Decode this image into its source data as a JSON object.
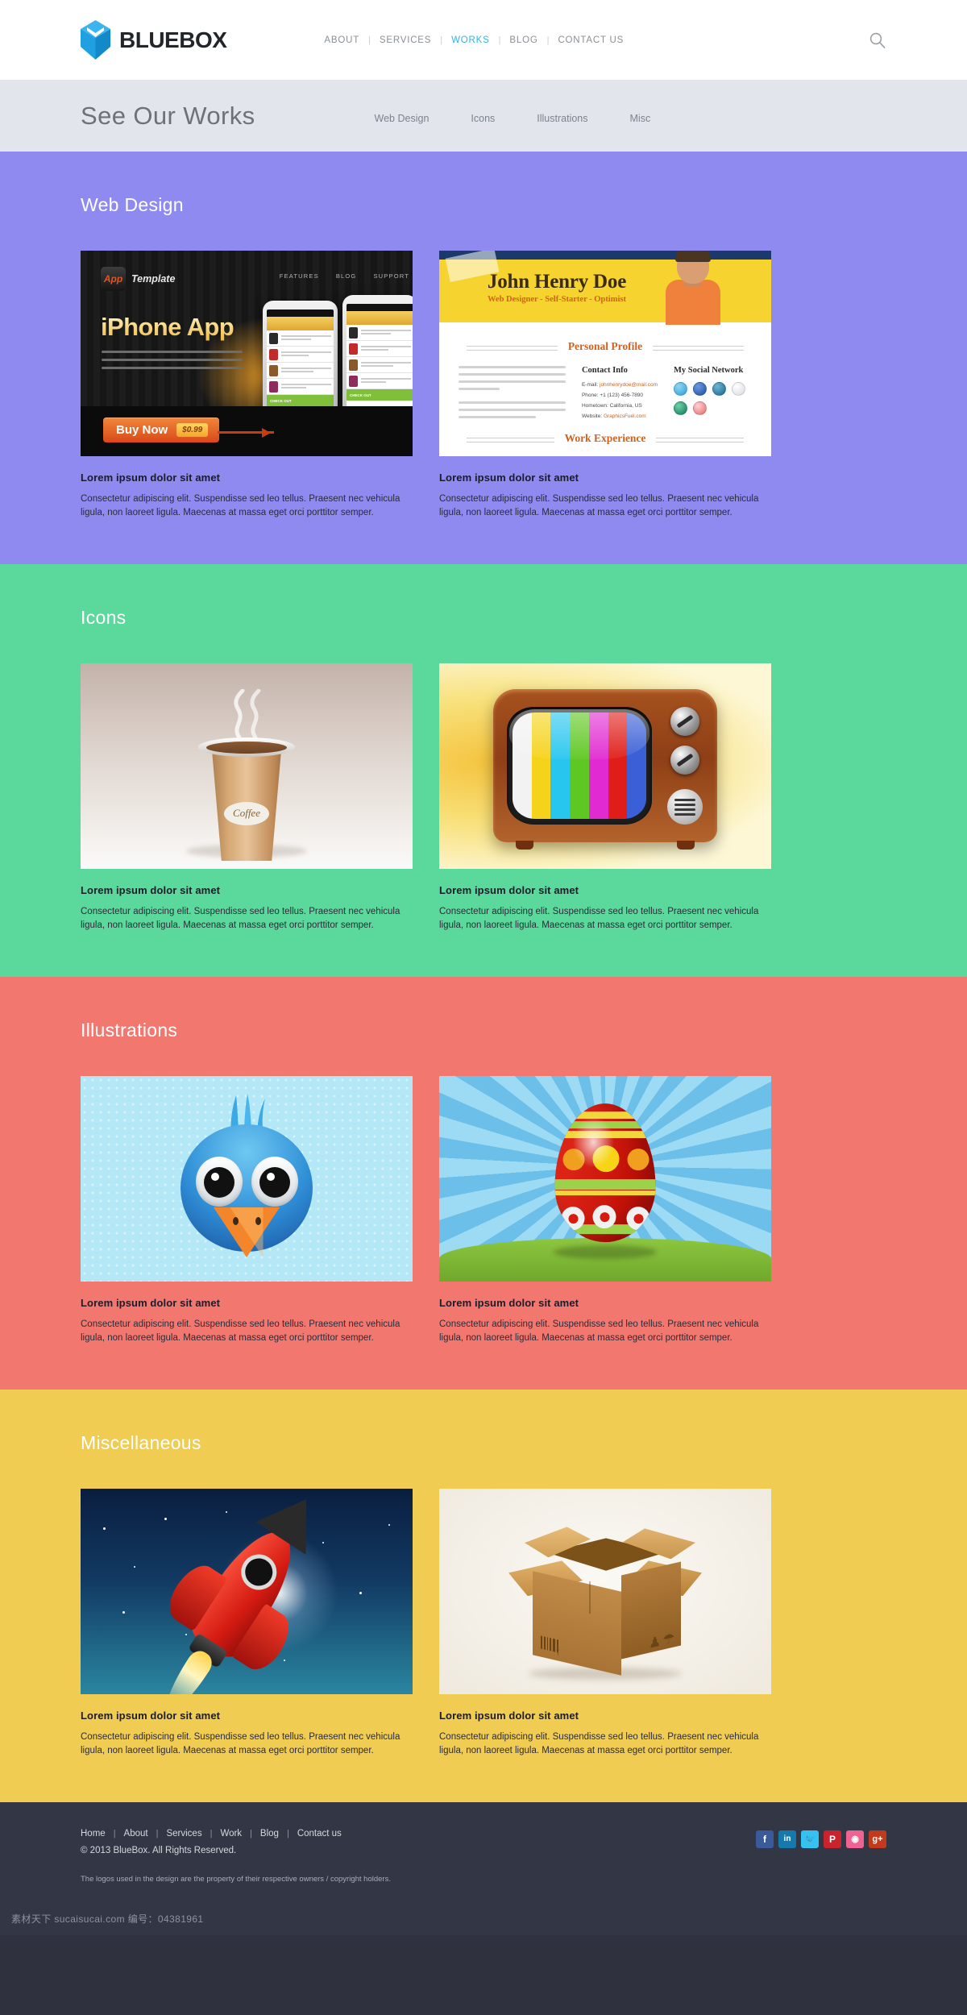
{
  "header": {
    "brand": "BLUEBOX",
    "nav": [
      {
        "label": "ABOUT",
        "active": false
      },
      {
        "label": "SERVICES",
        "active": false
      },
      {
        "label": "WORKS",
        "active": true
      },
      {
        "label": "BLOG",
        "active": false
      },
      {
        "label": "CONTACT US",
        "active": false
      }
    ],
    "separator": "|",
    "search_icon": "search-icon",
    "accent_color": "#2bb6e8"
  },
  "titlebar": {
    "title": "See Our Works",
    "filters": [
      "Web Design",
      "Icons",
      "Illustrations",
      "Misc"
    ]
  },
  "sections": [
    {
      "id": "web-design",
      "title": "Web Design",
      "bg": "#8e8af0",
      "cards": [
        {
          "title": "Lorem ipsum dolor sit amet",
          "desc": "Consectetur adipiscing elit. Suspendisse sed leo tellus. Praesent nec vehicula ligula, non laoreet ligula. Maecenas at massa eget orci porttitor semper.",
          "art": "iphone-app-promo"
        },
        {
          "title": "Lorem ipsum dolor sit amet",
          "desc": "Consectetur adipiscing elit. Suspendisse sed leo tellus. Praesent nec vehicula ligula, non laoreet ligula. Maecenas at massa eget orci porttitor semper.",
          "art": "resume-cv-template"
        }
      ]
    },
    {
      "id": "icons",
      "title": "Icons",
      "bg": "#5bd89b",
      "cards": [
        {
          "title": "Lorem ipsum dolor sit amet",
          "desc": "Consectetur adipiscing elit. Suspendisse sed leo tellus. Praesent nec vehicula ligula, non laoreet ligula. Maecenas at massa eget orci porttitor semper.",
          "art": "coffee-cup-icon"
        },
        {
          "title": "Lorem ipsum dolor sit amet",
          "desc": "Consectetur adipiscing elit. Suspendisse sed leo tellus. Praesent nec vehicula ligula, non laoreet ligula. Maecenas at massa eget orci porttitor semper.",
          "art": "retro-tv-icon"
        }
      ]
    },
    {
      "id": "illustrations",
      "title": "Illustrations",
      "bg": "#f2786f",
      "cards": [
        {
          "title": "Lorem ipsum dolor sit amet",
          "desc": "Consectetur adipiscing elit. Suspendisse sed leo tellus. Praesent nec vehicula ligula, non laoreet ligula. Maecenas at massa eget orci porttitor semper.",
          "art": "blue-bird-illustration"
        },
        {
          "title": "Lorem ipsum dolor sit amet",
          "desc": "Consectetur adipiscing elit. Suspendisse sed leo tellus. Praesent nec vehicula ligula, non laoreet ligula. Maecenas at massa eget orci porttitor semper.",
          "art": "easter-egg-illustration"
        }
      ]
    },
    {
      "id": "misc",
      "title": "Miscellaneous",
      "bg": "#f0cc52",
      "cards": [
        {
          "title": "Lorem ipsum dolor sit amet",
          "desc": "Consectetur adipiscing elit. Suspendisse sed leo tellus. Praesent nec vehicula ligula, non laoreet ligula. Maecenas at massa eget orci porttitor semper.",
          "art": "rocket-illustration"
        },
        {
          "title": "Lorem ipsum dolor sit amet",
          "desc": "Consectetur adipiscing elit. Suspendisse sed leo tellus. Praesent nec vehicula ligula, non laoreet ligula. Maecenas at massa eget orci porttitor semper.",
          "art": "cardboard-box-icon"
        }
      ]
    }
  ],
  "thumb_art": {
    "iphone": {
      "logo_badge": "App",
      "logo_word": "Template",
      "nav": [
        "FEATURES",
        "BLOG",
        "SUPPORT"
      ],
      "headline": "iPhone App",
      "buy_label": "Buy Now",
      "price": "$0.99",
      "checkout": "CHECK OUT"
    },
    "cv": {
      "name": "John Henry Doe",
      "role": "Web Designer - Self-Starter - Optimist",
      "profile_heading": "Personal Profile",
      "contact_heading": "Contact Info",
      "social_heading": "My Social Network",
      "work_heading": "Work Experience",
      "email_label": "E-mail:",
      "email": "johnhenrydoe@mail.com",
      "phone_label": "Phone:",
      "phone": "+1 (123) 456-7890",
      "hometown_label": "Hometown:",
      "hometown": "California, US",
      "website_label": "Website:",
      "website": "GraphicsFuel.com"
    },
    "coffee": {
      "label": "Coffee"
    },
    "tv": {
      "bars": [
        "#f2f2f2",
        "#f5d31a",
        "#27c6ef",
        "#5ec721",
        "#e12ad1",
        "#e01d18",
        "#3a5fd6"
      ]
    }
  },
  "footer": {
    "nav": [
      "Home",
      "About",
      "Services",
      "Work",
      "Blog",
      "Contact us"
    ],
    "separator": "|",
    "copyright": "© 2013 BlueBox.  All Rights Reserved.",
    "note": "The logos used in the design are the property of their respective owners / copyright holders.",
    "social": [
      {
        "name": "facebook",
        "glyph": "f",
        "color": "#3b5a9a"
      },
      {
        "name": "linkedin",
        "glyph": "in",
        "color": "#1579ac"
      },
      {
        "name": "twitter",
        "glyph": "🐦",
        "color": "#36c2f0"
      },
      {
        "name": "pinterest",
        "glyph": "P",
        "color": "#c9242d"
      },
      {
        "name": "dribbble",
        "glyph": "◉",
        "color": "#f06292"
      },
      {
        "name": "googleplus",
        "glyph": "g+",
        "color": "#c2391c"
      }
    ]
  },
  "watermark": "素材天下 sucaisucai.com  编号：04381961"
}
